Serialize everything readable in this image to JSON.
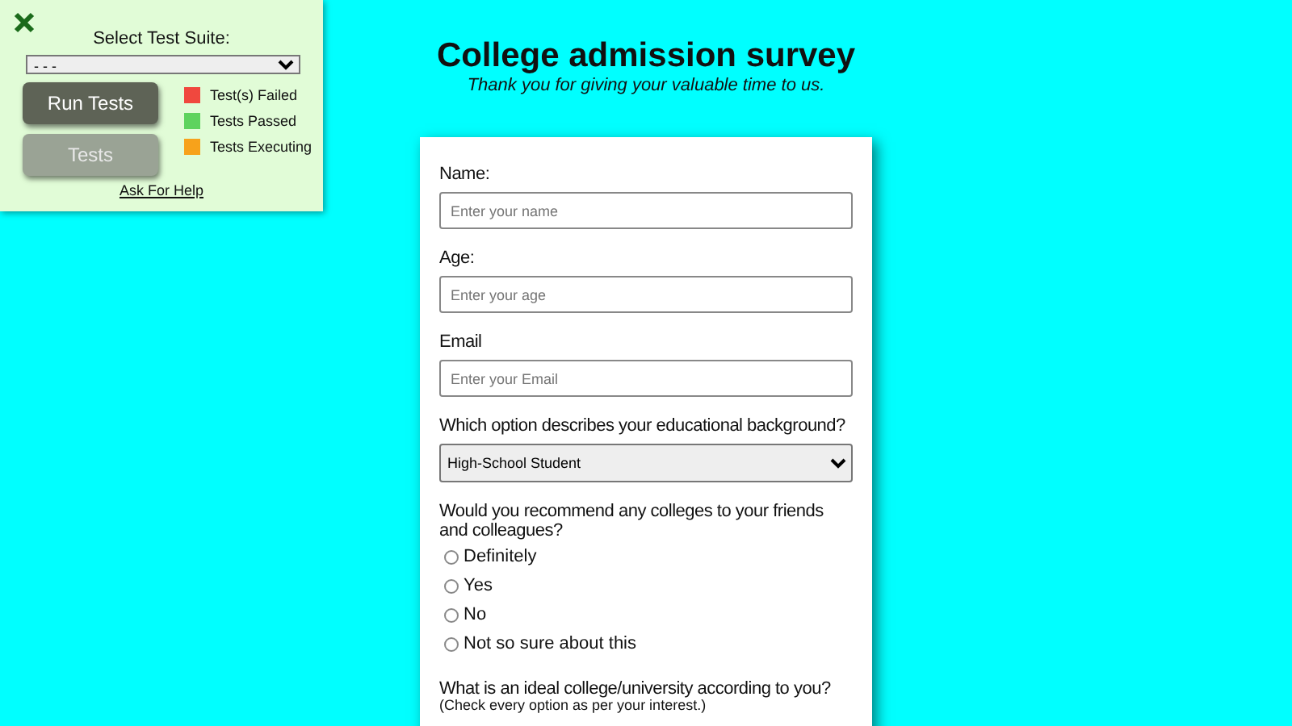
{
  "test_panel": {
    "title": "Select Test Suite:",
    "suite_select": {
      "value": "- - -"
    },
    "buttons": [
      {
        "label": "Run Tests",
        "disabled": false
      },
      {
        "label": "Tests",
        "disabled": true
      }
    ],
    "legend": [
      {
        "label": "Test(s) Failed",
        "color": "#f0483e"
      },
      {
        "label": "Tests Passed",
        "color": "#5ed35e"
      },
      {
        "label": "Tests Executing",
        "color": "#f7a21b"
      }
    ],
    "help_link": "Ask For Help"
  },
  "header": {
    "title": "College admission survey",
    "subtitle": "Thank you for giving your valuable time to us."
  },
  "form": {
    "fields": [
      {
        "kind": "text",
        "label": "Name:",
        "placeholder": "Enter your name"
      },
      {
        "kind": "text",
        "label": "Age:",
        "placeholder": "Enter your age"
      },
      {
        "kind": "text",
        "label": "Email",
        "placeholder": "Enter your Email"
      },
      {
        "kind": "select",
        "label": "Which option describes your educational background?",
        "value": "High-School Student"
      },
      {
        "kind": "radio",
        "label": "Would you recommend any colleges to your friends and colleagues?",
        "options": [
          {
            "label": "Definitely",
            "selected": false
          },
          {
            "label": "Yes",
            "selected": false
          },
          {
            "label": "No",
            "selected": false
          },
          {
            "label": "Not so sure about this",
            "selected": false
          }
        ]
      },
      {
        "kind": "checklist",
        "label": "What is an ideal college/university according to you?",
        "note": "(Check every option as per your interest.)"
      }
    ]
  }
}
